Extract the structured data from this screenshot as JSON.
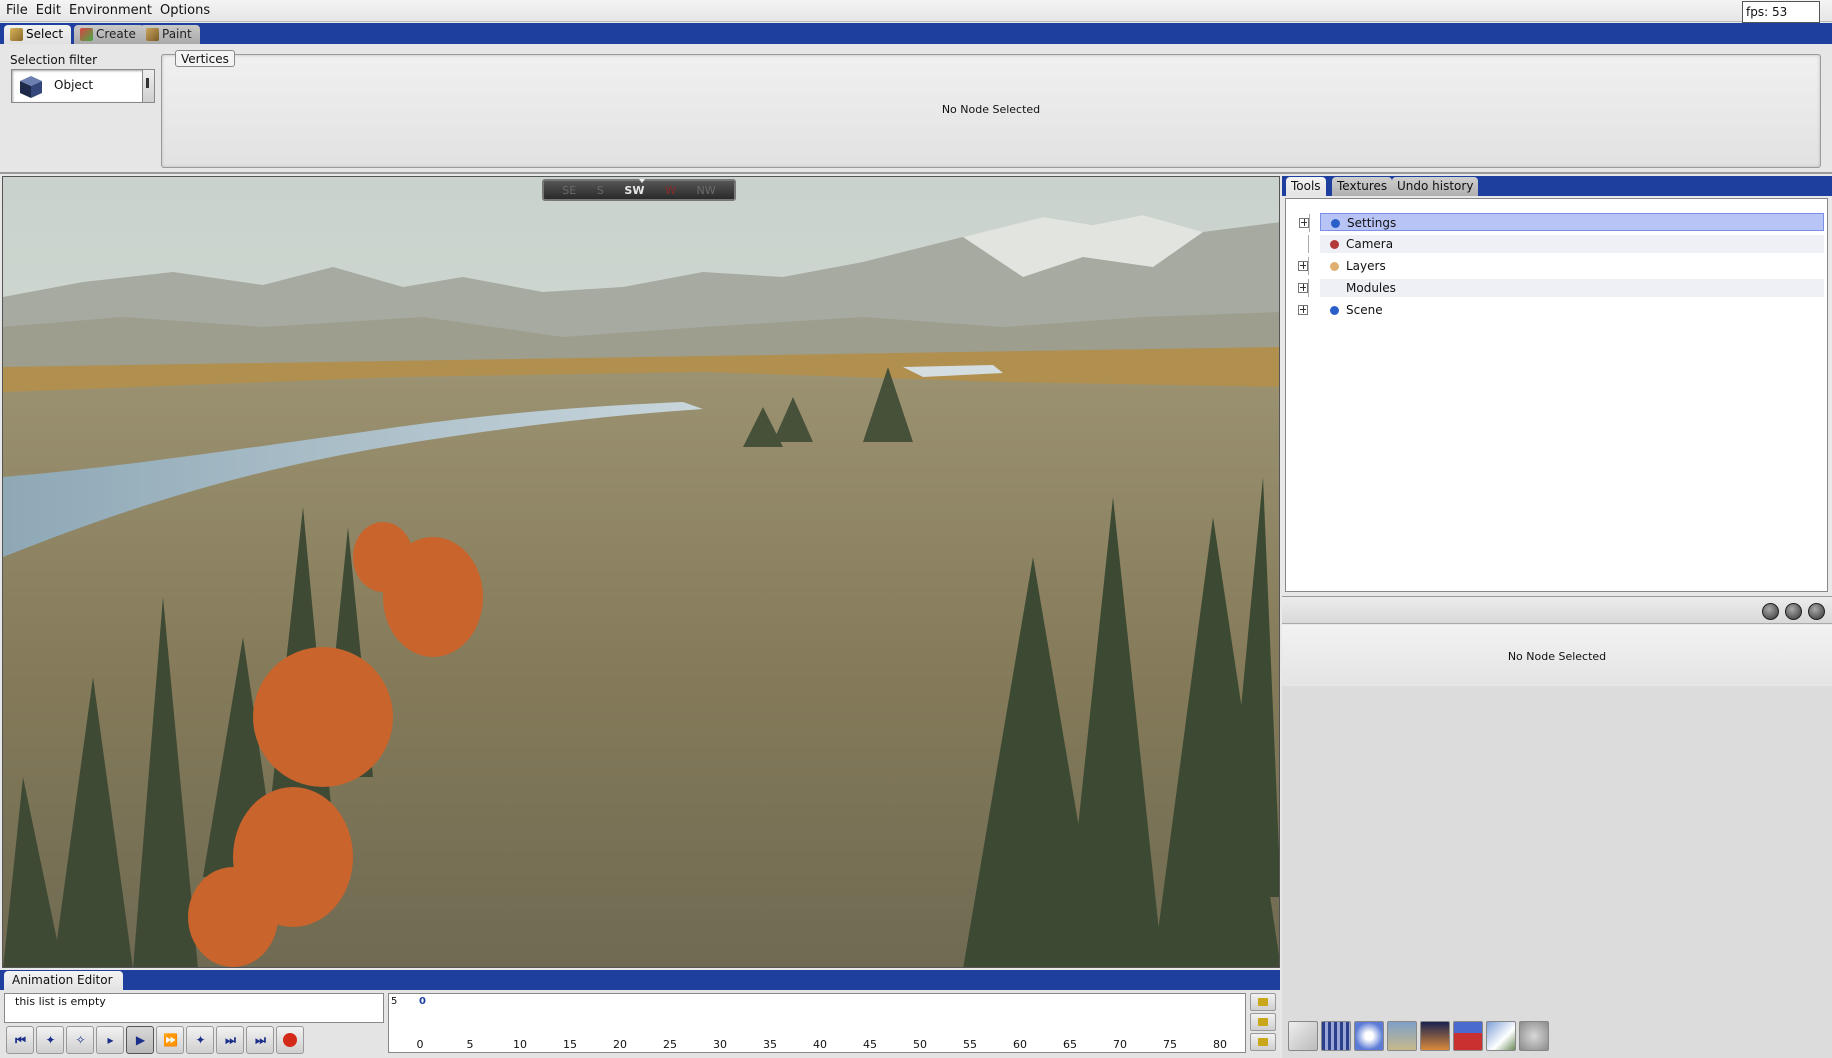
{
  "menu": {
    "items": [
      "File",
      "Edit",
      "Environment",
      "Options"
    ]
  },
  "fps": "fps: 53",
  "main_tabs": [
    {
      "label": "Select",
      "icon": "select-icon"
    },
    {
      "label": "Create",
      "icon": "create-icon"
    },
    {
      "label": "Paint",
      "icon": "paint-icon"
    }
  ],
  "selection": {
    "filter_label": "Selection filter",
    "filter_value": "Object",
    "vertices_tab": "Vertices",
    "vertices_message": "No Node Selected"
  },
  "compass": {
    "directions": [
      "SE",
      "S",
      "SW",
      "W",
      "NW"
    ],
    "current": "SW"
  },
  "right_panel": {
    "tabs": [
      "Tools",
      "Textures",
      "Undo history"
    ],
    "tree": [
      {
        "label": "Settings",
        "icon": "settings-icon",
        "selected": true
      },
      {
        "label": "Camera",
        "icon": "camera-icon",
        "selected": false
      },
      {
        "label": "Layers",
        "icon": "layers-icon",
        "selected": false
      },
      {
        "label": "Modules",
        "icon": "",
        "selected": false
      },
      {
        "label": "Scene",
        "icon": "scene-icon",
        "selected": false
      }
    ],
    "properties_message": "No Node Selected"
  },
  "animation": {
    "tab": "Animation Editor",
    "list_empty": "this list is empty",
    "timeline_start": "5",
    "timeline_current": "0",
    "ticks": [
      "0",
      "5",
      "10",
      "15",
      "20",
      "25",
      "30",
      "35",
      "40",
      "45",
      "50",
      "55",
      "60",
      "65",
      "70",
      "75",
      "80"
    ]
  },
  "colors": {
    "accent_blue": "#1e3f9e",
    "selection": "#b8c4f6",
    "record": "#d42a1a"
  }
}
